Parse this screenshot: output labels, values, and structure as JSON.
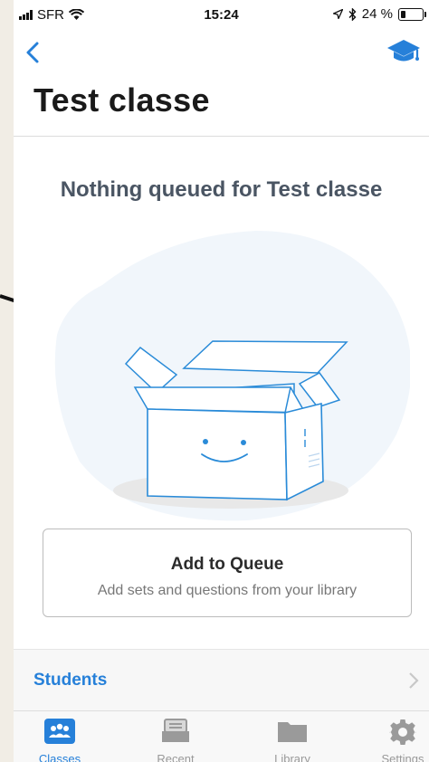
{
  "status_bar": {
    "carrier": "SFR",
    "time": "15:24",
    "battery": "24 %"
  },
  "header": {
    "title": "Test classe"
  },
  "empty_state": {
    "message": "Nothing queued for Test classe"
  },
  "queue_button": {
    "title": "Add to Queue",
    "subtitle": "Add sets and questions from your library"
  },
  "students_row": {
    "label": "Students"
  },
  "tabs": [
    {
      "label": "Classes",
      "icon": "classes-icon",
      "active": true
    },
    {
      "label": "Recent",
      "icon": "recent-icon",
      "active": false
    },
    {
      "label": "Library",
      "icon": "folder-icon",
      "active": false
    },
    {
      "label": "Settings",
      "icon": "gear-icon",
      "active": false
    }
  ],
  "colors": {
    "accent": "#2680d9",
    "illustration_stroke": "#2a8bd8",
    "blob": "#f1f6fb"
  }
}
